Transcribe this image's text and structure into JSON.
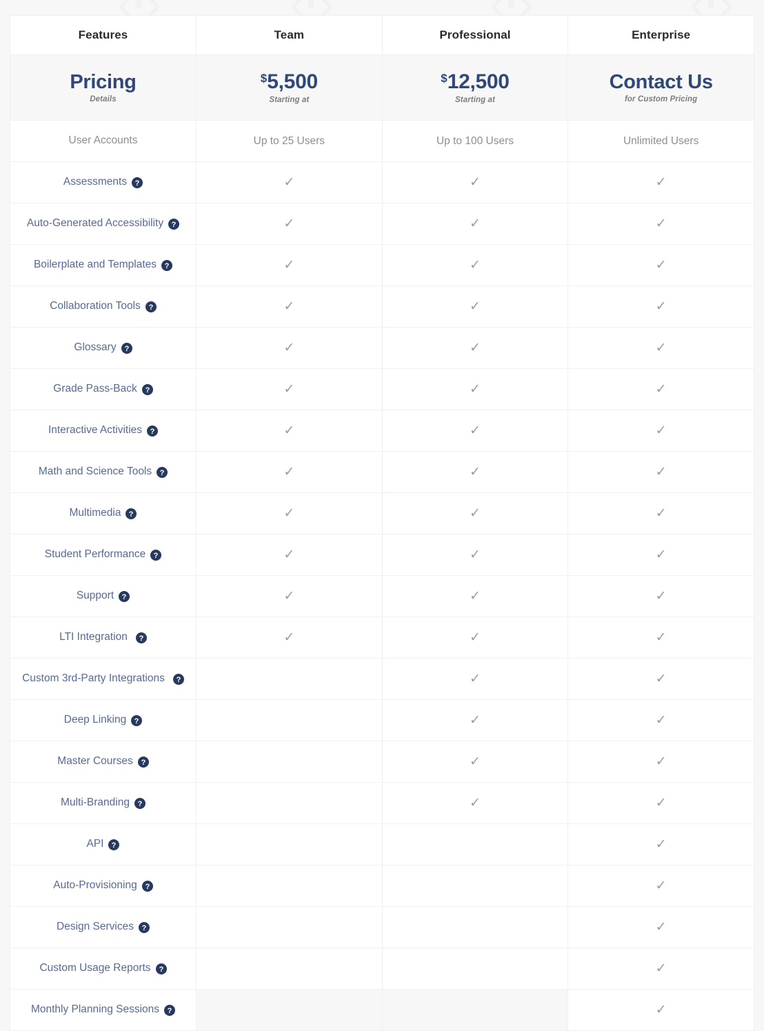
{
  "table": {
    "columns": [
      "Features",
      "Team",
      "Professional",
      "Enterprise"
    ],
    "pricing_row": {
      "feature": {
        "title": "Pricing",
        "subtitle": "Details"
      },
      "plans": [
        {
          "currency": "$",
          "amount": "5,500",
          "subtitle": "Starting at"
        },
        {
          "currency": "$",
          "amount": "12,500",
          "subtitle": "Starting at"
        },
        {
          "currency": "",
          "amount": "Contact Us",
          "subtitle": "for Custom Pricing"
        }
      ]
    },
    "help_icon_name": "help-circle-icon",
    "check_glyph": "✓",
    "rows": [
      {
        "feature": "User Accounts",
        "help": false,
        "team": "Up to 25 Users",
        "professional": "Up to 100 Users",
        "enterprise": "Unlimited Users",
        "type": "text"
      },
      {
        "feature": "Assessments",
        "help": true,
        "team": true,
        "professional": true,
        "enterprise": true,
        "type": "check"
      },
      {
        "feature": "Auto-Generated Accessibility",
        "help": true,
        "team": true,
        "professional": true,
        "enterprise": true,
        "type": "check"
      },
      {
        "feature": "Boilerplate and Templates",
        "help": true,
        "team": true,
        "professional": true,
        "enterprise": true,
        "type": "check"
      },
      {
        "feature": "Collaboration Tools",
        "help": true,
        "team": true,
        "professional": true,
        "enterprise": true,
        "type": "check"
      },
      {
        "feature": "Glossary",
        "help": true,
        "team": true,
        "professional": true,
        "enterprise": true,
        "type": "check"
      },
      {
        "feature": "Grade Pass-Back",
        "help": true,
        "team": true,
        "professional": true,
        "enterprise": true,
        "type": "check"
      },
      {
        "feature": "Interactive Activities",
        "help": true,
        "team": true,
        "professional": true,
        "enterprise": true,
        "type": "check"
      },
      {
        "feature": "Math and Science Tools",
        "help": true,
        "team": true,
        "professional": true,
        "enterprise": true,
        "type": "check"
      },
      {
        "feature": "Multimedia",
        "help": true,
        "team": true,
        "professional": true,
        "enterprise": true,
        "type": "check"
      },
      {
        "feature": "Student Performance",
        "help": true,
        "team": true,
        "professional": true,
        "enterprise": true,
        "type": "check"
      },
      {
        "feature": "Support",
        "help": true,
        "team": true,
        "professional": true,
        "enterprise": true,
        "type": "check"
      },
      {
        "feature": "LTI Integration",
        "help": true,
        "wide_gap": true,
        "team": true,
        "professional": true,
        "enterprise": true,
        "type": "check"
      },
      {
        "feature": "Custom 3rd-Party Integrations",
        "help": true,
        "wide_gap": true,
        "team": false,
        "professional": true,
        "enterprise": true,
        "type": "check"
      },
      {
        "feature": "Deep Linking",
        "help": true,
        "team": false,
        "professional": true,
        "enterprise": true,
        "type": "check"
      },
      {
        "feature": "Master Courses",
        "help": true,
        "team": false,
        "professional": true,
        "enterprise": true,
        "type": "check"
      },
      {
        "feature": "Multi-Branding",
        "help": true,
        "team": false,
        "professional": true,
        "enterprise": true,
        "type": "check"
      },
      {
        "feature": "API",
        "help": true,
        "team": false,
        "professional": false,
        "enterprise": true,
        "type": "check"
      },
      {
        "feature": "Auto-Provisioning",
        "help": true,
        "team": false,
        "professional": false,
        "enterprise": true,
        "type": "check"
      },
      {
        "feature": "Design Services",
        "help": true,
        "team": false,
        "professional": false,
        "enterprise": true,
        "type": "check"
      },
      {
        "feature": "Custom Usage Reports",
        "help": true,
        "team": false,
        "professional": false,
        "enterprise": true,
        "type": "check"
      },
      {
        "feature": "Monthly Planning Sessions",
        "help": true,
        "team": false,
        "professional": false,
        "enterprise": true,
        "type": "check",
        "shade_empty": true
      }
    ]
  },
  "colors": {
    "accent_navy": "#2f4878",
    "feature_text": "#566a94",
    "muted_text": "#8d8d95",
    "header_text": "#2b2b2f",
    "row_shade": "#f7f7f8",
    "border": "#f0f0f2",
    "page_bg": "#f7f7f7"
  }
}
